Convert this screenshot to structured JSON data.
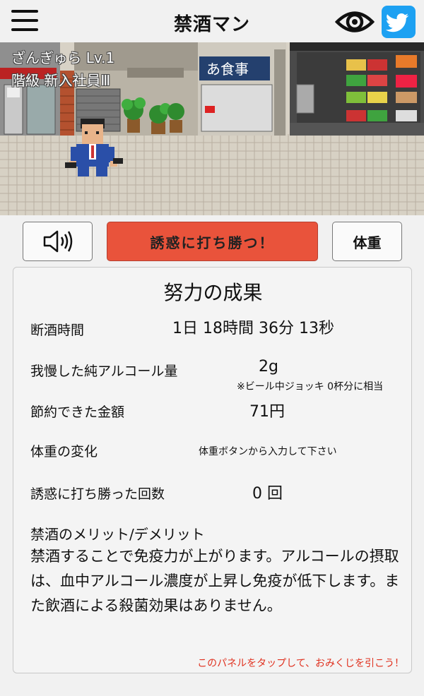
{
  "header": {
    "title": "禁酒マン",
    "menu_icon": "hamburger-menu-icon",
    "eye_icon": "eye-icon",
    "twitter_icon": "twitter-bird-icon",
    "twitter_color": "#1da1f2"
  },
  "scene": {
    "level_line": "ざんぎゅら Lv.1",
    "rank_line": "階級 新入社員Ⅲ",
    "shop_sign": "あ食事"
  },
  "buttons": {
    "sound_icon": "speaker-icon",
    "tempt_label": "誘惑に打ち勝つ！",
    "tempt_color": "#e9533b",
    "weight_label": "体重"
  },
  "panel": {
    "title": "努力の成果",
    "rows": {
      "abstinence_time": {
        "label": "断酒時間",
        "value": "1日 18時間 36分 13秒"
      },
      "alcohol": {
        "label": "我慢した純アルコール量",
        "value": "2g",
        "note": "※ビール中ジョッキ 0杯分に相当"
      },
      "money": {
        "label": "節約できた金額",
        "value": "71円"
      },
      "weight_change": {
        "label": "体重の変化",
        "value": "体重ボタンから入力して下さい"
      },
      "temptation": {
        "label": "誘惑に打ち勝った回数",
        "value": "0 回"
      }
    },
    "merit_title": "禁酒のメリット/デメリット",
    "merit_body": "禁酒することで免疫力が上がります。アルコールの摂取は、血中アルコール濃度が上昇し免疫が低下します。また飲酒による殺菌効果はありません。",
    "omikuji": "このパネルをタップして、おみくじを引こう！",
    "omikuji_color": "#e0301e"
  }
}
